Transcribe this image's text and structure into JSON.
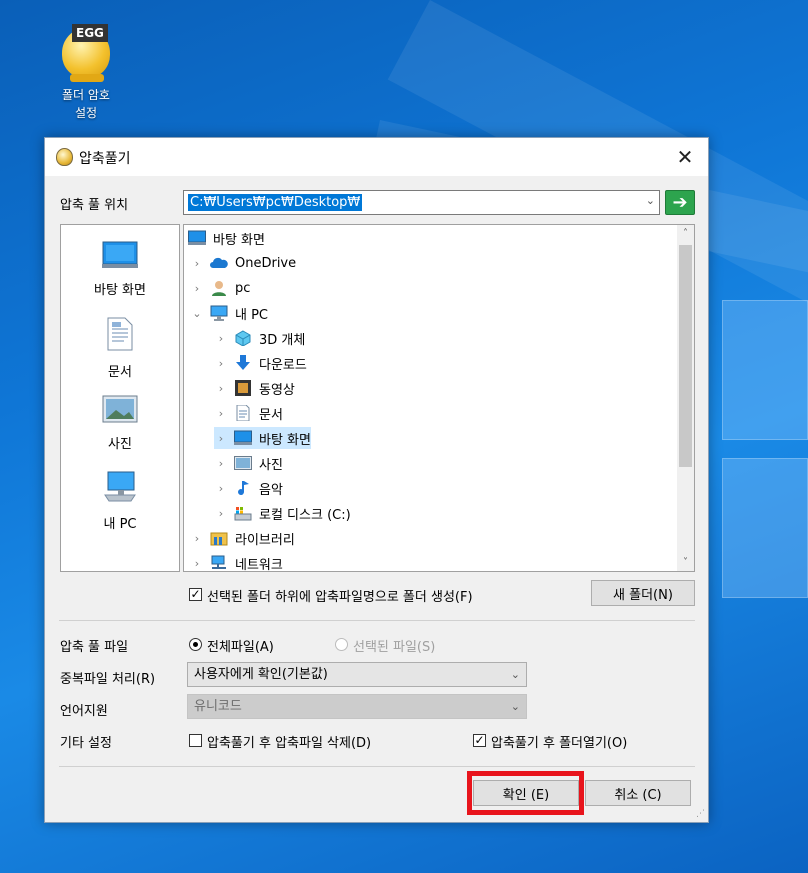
{
  "desktop": {
    "icon_badge": "EGG",
    "icon_label_line1": "폴더 암호",
    "icon_label_line2": "설정"
  },
  "dialog": {
    "title": "압축풀기",
    "close_glyph": "✕",
    "location_label": "압축 풀 위치",
    "path_value": "C:₩Users₩pc₩Desktop₩",
    "go_glyph": "➔",
    "places": [
      {
        "label": "바탕 화면",
        "icon": "desktop-icon"
      },
      {
        "label": "문서",
        "icon": "documents-icon"
      },
      {
        "label": "사진",
        "icon": "pictures-icon"
      },
      {
        "label": "내 PC",
        "icon": "computer-icon"
      }
    ],
    "tree": [
      {
        "label": "바탕 화면",
        "icon": "desktop-icon",
        "indent": 0,
        "chevron": ""
      },
      {
        "label": "OneDrive",
        "icon": "onedrive-icon",
        "indent": 1,
        "chevron": ">"
      },
      {
        "label": "pc",
        "icon": "user-icon",
        "indent": 1,
        "chevron": ">"
      },
      {
        "label": "내 PC",
        "icon": "computer-icon",
        "indent": 1,
        "chevron": "v"
      },
      {
        "label": "3D 개체",
        "icon": "3d-objects-icon",
        "indent": 2,
        "chevron": ">"
      },
      {
        "label": "다운로드",
        "icon": "downloads-icon",
        "indent": 2,
        "chevron": ">"
      },
      {
        "label": "동영상",
        "icon": "videos-icon",
        "indent": 2,
        "chevron": ">"
      },
      {
        "label": "문서",
        "icon": "documents-icon",
        "indent": 2,
        "chevron": ">"
      },
      {
        "label": "바탕 화면",
        "icon": "desktop-icon",
        "indent": 2,
        "chevron": ">",
        "selected": true
      },
      {
        "label": "사진",
        "icon": "pictures-icon",
        "indent": 2,
        "chevron": ">"
      },
      {
        "label": "음악",
        "icon": "music-icon",
        "indent": 2,
        "chevron": ">"
      },
      {
        "label": "로컬 디스크 (C:)",
        "icon": "drive-icon",
        "indent": 2,
        "chevron": ">"
      },
      {
        "label": "라이브러리",
        "icon": "libraries-icon",
        "indent": 1,
        "chevron": ">"
      },
      {
        "label": "네트워크",
        "icon": "network-icon",
        "indent": 1,
        "chevron": ">"
      }
    ],
    "create_subfolder_label": "선택된 폴더 하위에 압축파일명으로 폴더 생성(F)",
    "create_subfolder_checked": true,
    "new_folder_button": "새 폴더(N)",
    "extract_files_label": "압축 풀 파일",
    "radio_all": "전체파일(A)",
    "radio_selected": "선택된 파일(S)",
    "duplicate_label": "중복파일 처리(R)",
    "duplicate_value": "사용자에게 확인(기본값)",
    "language_label": "언어지원",
    "language_value": "유니코드",
    "other_label": "기타 설정",
    "delete_after_label": "압축풀기 후 압축파일 삭제(D)",
    "delete_after_checked": false,
    "open_after_label": "압축풀기 후 폴더열기(O)",
    "open_after_checked": true,
    "ok_button": "확인 (E)",
    "cancel_button": "취소 (C)",
    "checkmark": "✓",
    "arrow_down": "⌄",
    "scroll_up": "˄",
    "scroll_down": "˅"
  }
}
